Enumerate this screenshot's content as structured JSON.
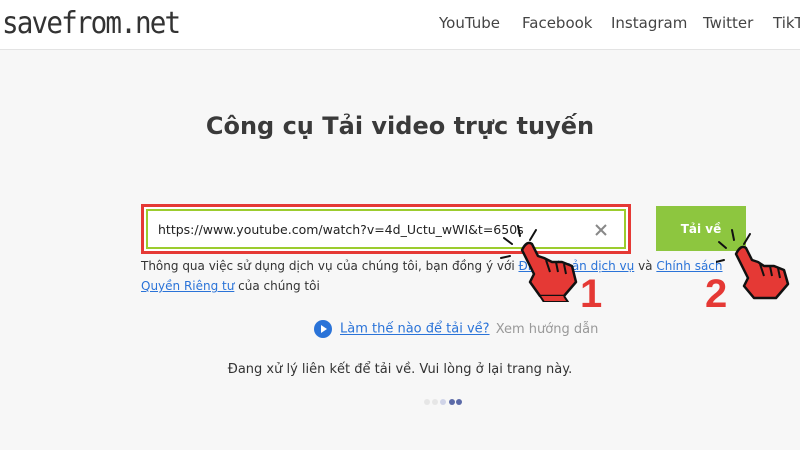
{
  "header": {
    "logo": "savefrom.net",
    "nav": [
      "YouTube",
      "Facebook",
      "Instagram",
      "Twitter",
      "TikT"
    ]
  },
  "main": {
    "title": "Công cụ Tải video trực tuyến",
    "url_value": "https://www.youtube.com/watch?v=4d_Uctu_wWI&t=650s",
    "download_label": "Tải về",
    "terms_prefix": "Thông qua việc sử dụng dịch vụ của chúng tôi, bạn đồng ý với ",
    "terms_link1": "Điều khoản dịch vụ",
    "terms_mid": " và ",
    "terms_link2": "Chính sách Quyền Riêng tư",
    "terms_suffix": " của chúng tôi",
    "help_link": "Làm thế nào để tải về?",
    "help_sub": "Xem hướng dẫn",
    "status_text": "Đang xử lý liên kết để tải về. Vui lòng ở lại trang này."
  },
  "annotations": {
    "step1": "1",
    "step2": "2",
    "highlight_color": "#e53935",
    "accent_green": "#8dc63f",
    "link_blue": "#2a73d8"
  }
}
